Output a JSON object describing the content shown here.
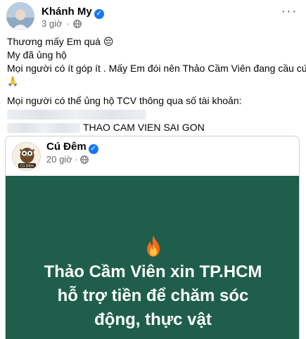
{
  "post": {
    "author": "Khánh My",
    "time": "3 giờ",
    "dot": "·",
    "more_label": "···",
    "lines": [
      "Thương mấy Em quá 😔",
      "My đã ủng hộ",
      "Mọi người có ít góp ít . Mấy Em đói nên Thảo Cầm Viên đang cầu cứu",
      "🙏",
      "Mọi người có thể ủng hộ TCV thông qua số tài khoản:"
    ],
    "account_name": "THAO CAM VIEN SAI GON"
  },
  "shared": {
    "author": "Cú Đêm",
    "avatar_text": "Cú Đêm",
    "time": "20 giờ",
    "dot": "·",
    "headline_lines": [
      "Thảo Cầm Viên xin TP.HCM",
      "hỗ trợ tiền để chăm sóc",
      "động, thực vật"
    ],
    "media_color": "#1f5e4b"
  },
  "colors": {
    "verified": "#1877f2",
    "secondary_text": "#65676b"
  },
  "icons": [
    "verified-icon",
    "globe-icon",
    "more-options-icon",
    "fire-icon"
  ]
}
